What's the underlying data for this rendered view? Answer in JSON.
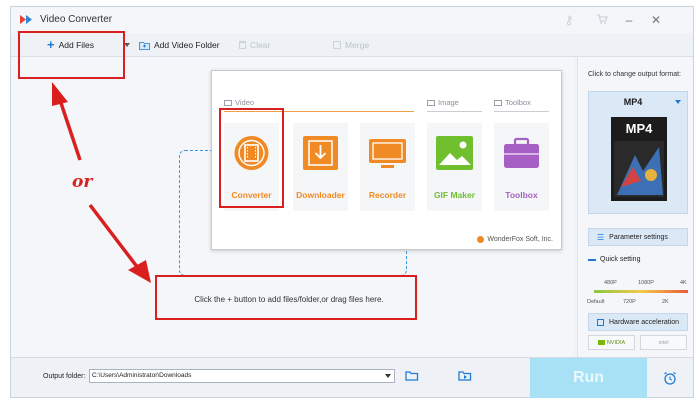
{
  "window": {
    "title": "Video Converter"
  },
  "toolbar": {
    "add_files": "Add Files",
    "add_folder": "Add Video Folder",
    "clear": "Clear",
    "merge": "Merge"
  },
  "panel": {
    "sections": {
      "video": "Video",
      "image": "Image",
      "toolbox": "Toolbox"
    },
    "tools": [
      {
        "label": "Converter",
        "color": "#f08a24"
      },
      {
        "label": "Downloader",
        "color": "#f08a24"
      },
      {
        "label": "Recorder",
        "color": "#f08a24"
      },
      {
        "label": "GIF Maker",
        "color": "#6fbf2e"
      },
      {
        "label": "Toolbox",
        "color": "#a65fc4"
      }
    ],
    "brand": "WonderFox Soft, Inc."
  },
  "work": {
    "hint": "Click the + button to add files/folder,or drag files here."
  },
  "annotation": {
    "or": "or"
  },
  "output": {
    "caption": "Click to change output format:",
    "format": "MP4",
    "format_art": "MP4",
    "parameter_settings": "Parameter settings",
    "quick_setting": "Quick setting",
    "res_top": [
      "480P",
      "1080P",
      "4K"
    ],
    "res_bottom": [
      "Default",
      "720P",
      "2K"
    ],
    "hardware_acceleration": "Hardware acceleration",
    "nvidia": "NVIDIA",
    "intel": "intel"
  },
  "bottom": {
    "output_folder_label": "Output folder:",
    "output_folder_value": "C:\\Users\\Administrator\\Downloads",
    "run": "Run"
  },
  "colors": {
    "accent": "#1f7ad4",
    "orange": "#f08a24",
    "annotation_red": "#d9201f",
    "run_bg": "#a8e0f6"
  }
}
